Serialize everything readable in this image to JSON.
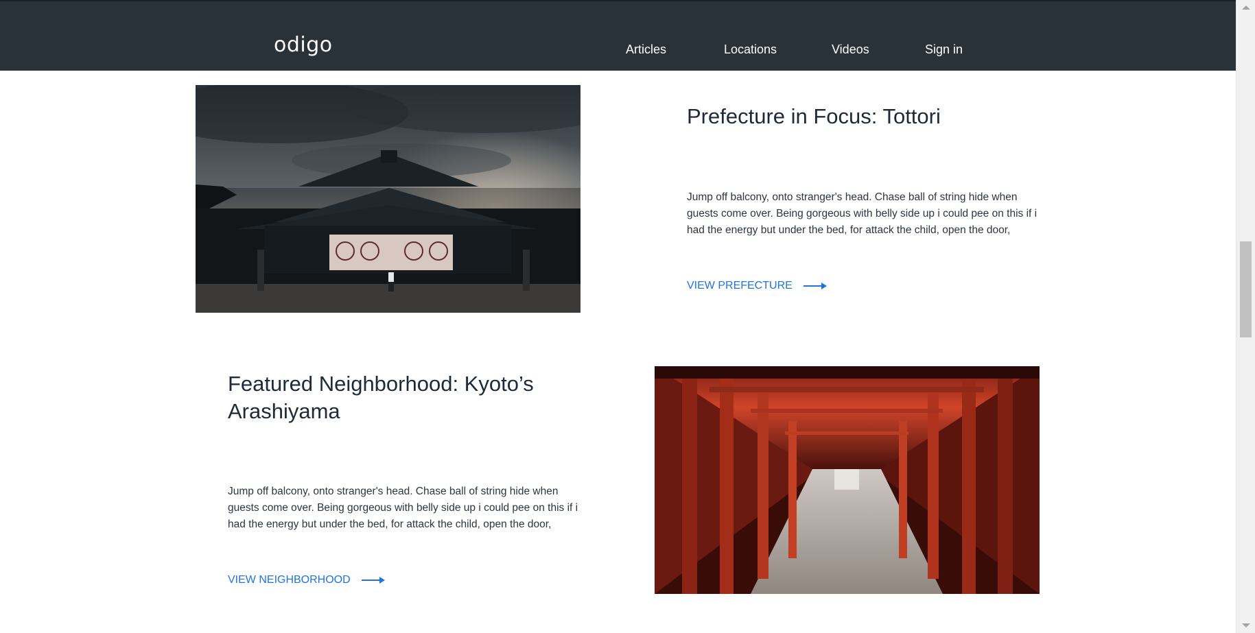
{
  "header": {
    "logo": "odigo",
    "nav": [
      "Articles",
      "Locations",
      "Videos",
      "Sign in"
    ]
  },
  "sections": [
    {
      "title": "Prefecture in Focus: Tottori",
      "body": "Jump off balcony, onto stranger's head. Chase ball of string hide when guests come over. Being gorgeous with belly side up i could pee on this if i had the energy but under the bed, for attack the child, open the door,",
      "cta": "VIEW PREFECTURE",
      "image": "temple-photo"
    },
    {
      "title": "Featured Neighborhood: Kyoto’s Arashiyama",
      "body": "Jump off balcony, onto stranger's head. Chase ball of string hide when guests come over. Being gorgeous with belly side up i could pee on this if i had the energy but under the bed, for attack the child, open the door,",
      "cta": "VIEW NEIGHBORHOOD",
      "image": "torii-gates-photo"
    }
  ],
  "colors": {
    "header_bg": "#283238",
    "accent": "#1f73e3",
    "title_text": "#1e2a3a"
  }
}
